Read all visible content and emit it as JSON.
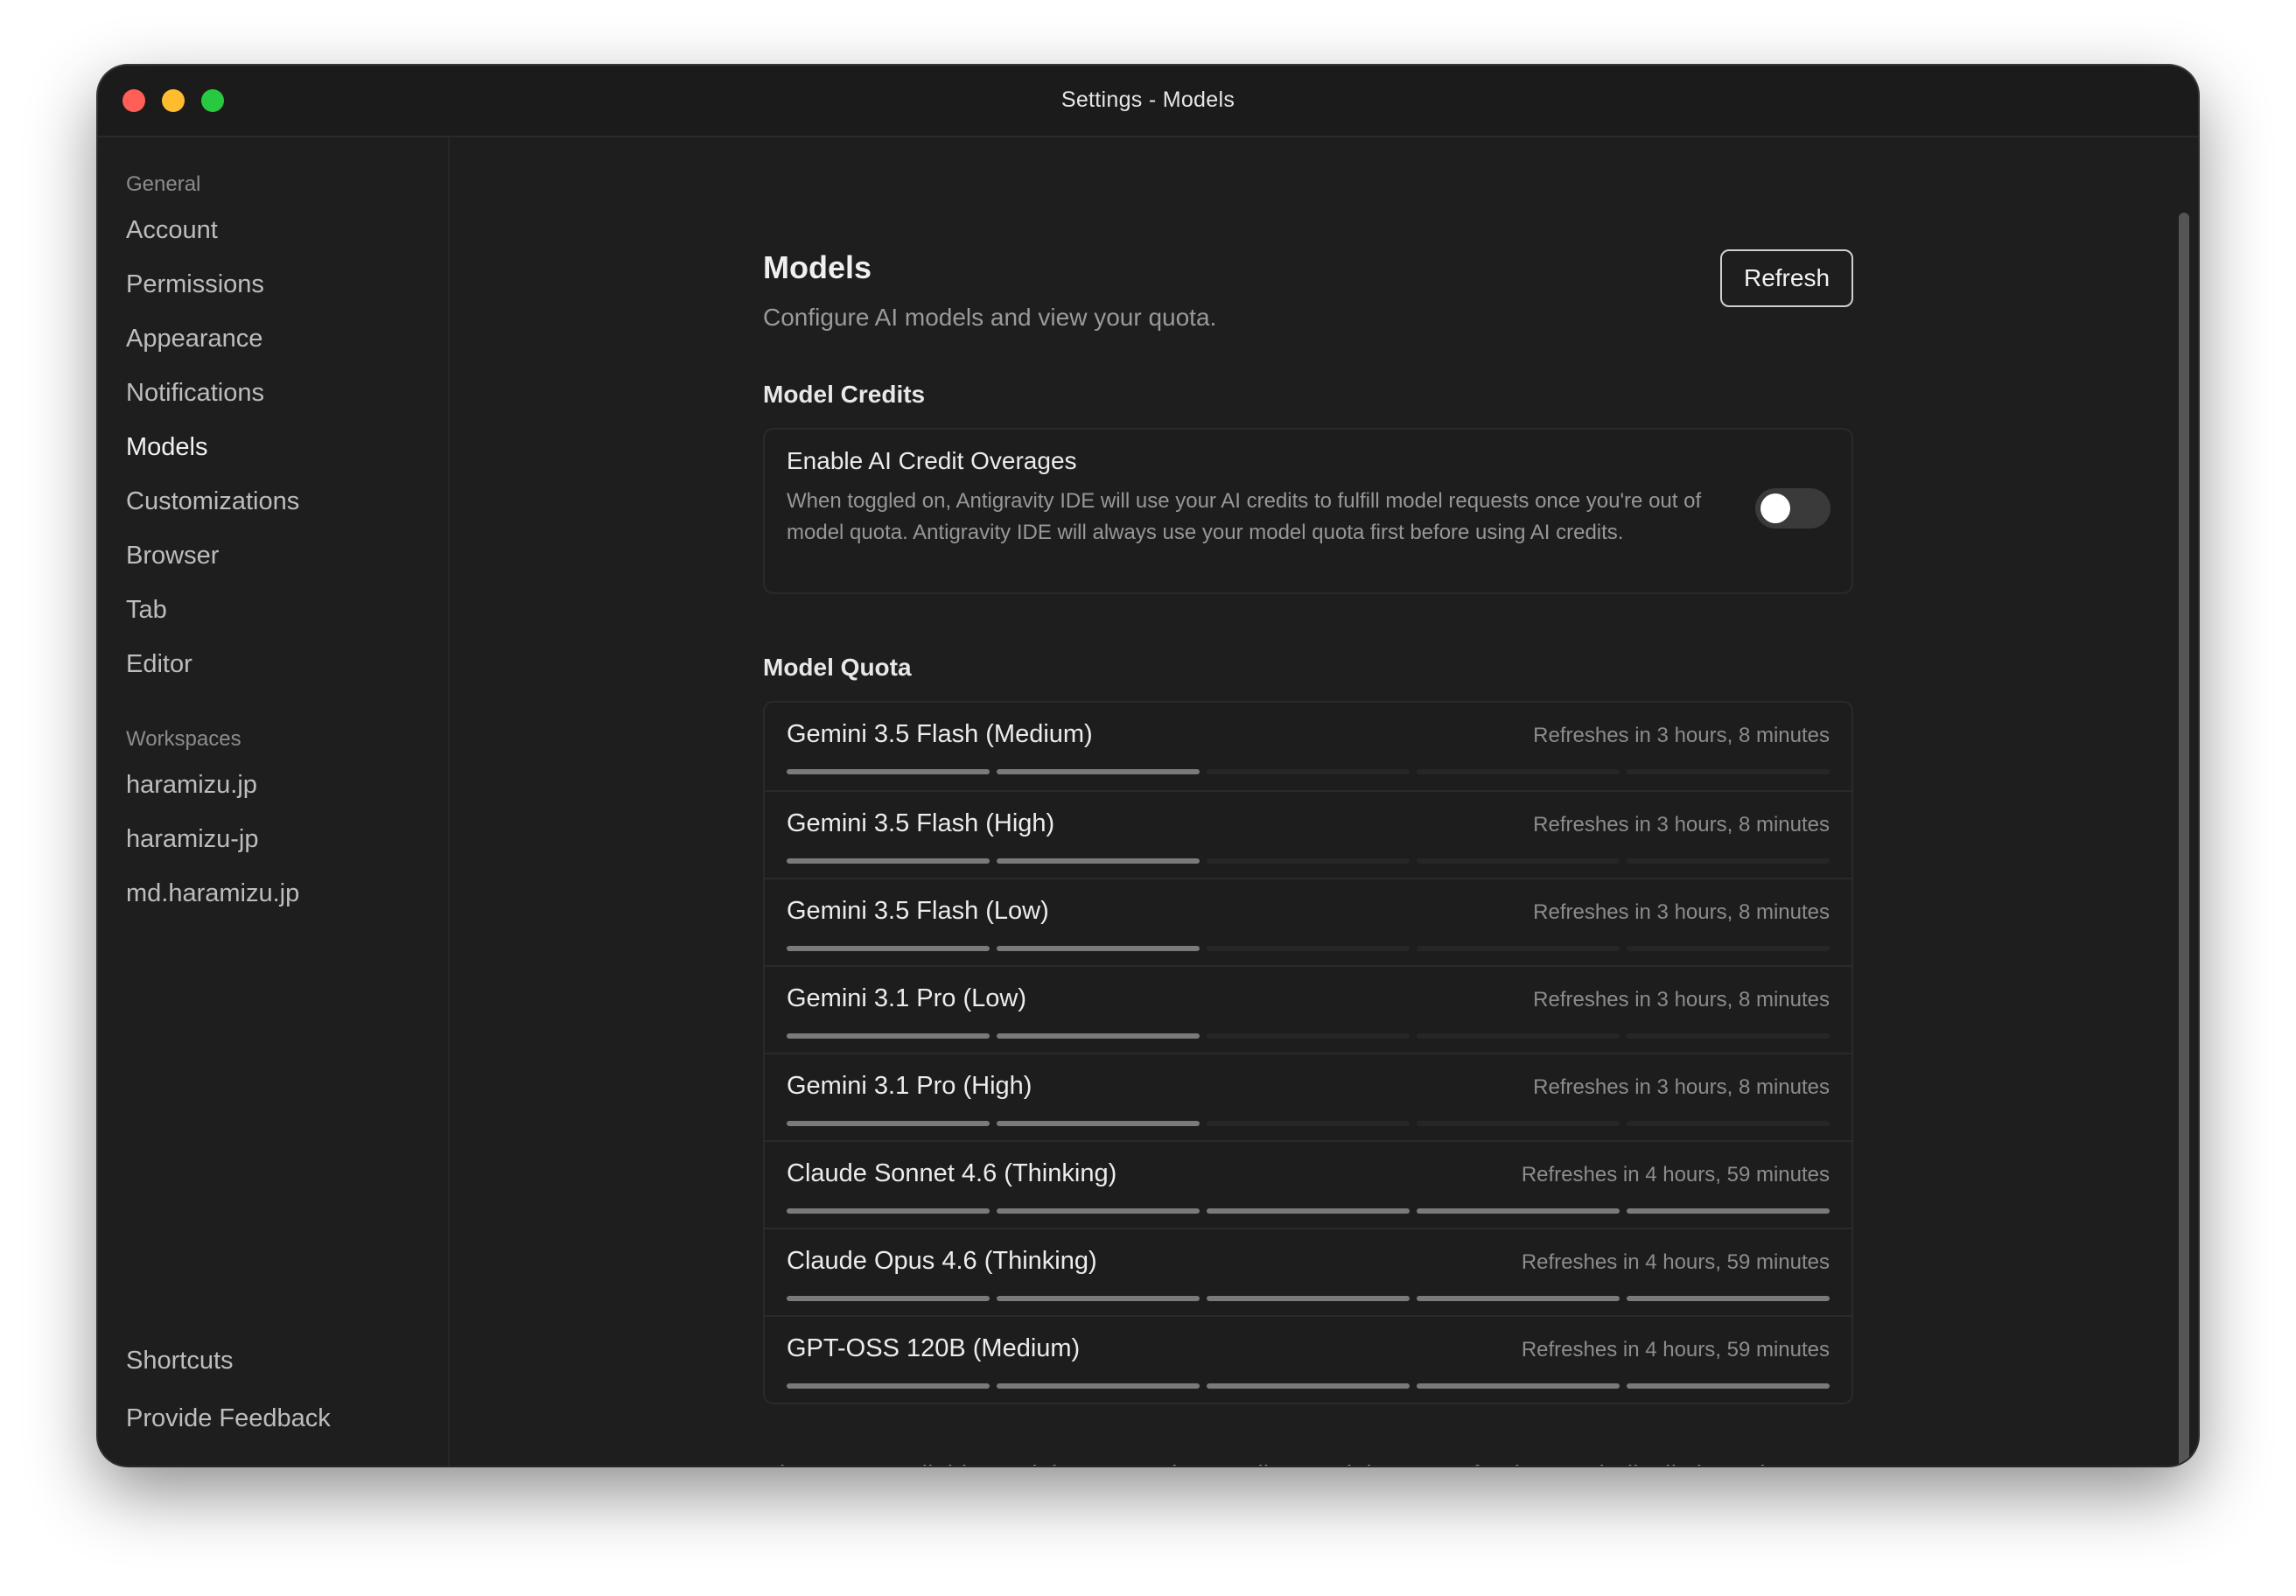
{
  "window": {
    "title": "Settings - Models"
  },
  "sidebar": {
    "general_label": "General",
    "general_items": [
      {
        "label": "Account",
        "active": false
      },
      {
        "label": "Permissions",
        "active": false
      },
      {
        "label": "Appearance",
        "active": false
      },
      {
        "label": "Notifications",
        "active": false
      },
      {
        "label": "Models",
        "active": true
      },
      {
        "label": "Customizations",
        "active": false
      },
      {
        "label": "Browser",
        "active": false
      },
      {
        "label": "Tab",
        "active": false
      },
      {
        "label": "Editor",
        "active": false
      }
    ],
    "workspaces_label": "Workspaces",
    "workspaces": [
      {
        "label": "haramizu.jp"
      },
      {
        "label": "haramizu-jp"
      },
      {
        "label": "md.haramizu.jp"
      }
    ],
    "bottom_items": [
      {
        "label": "Shortcuts"
      },
      {
        "label": "Provide Feedback"
      }
    ]
  },
  "main": {
    "title": "Models",
    "subtitle": "Configure AI models and view your quota.",
    "refresh_label": "Refresh",
    "credits_heading": "Model Credits",
    "overage": {
      "title": "Enable AI Credit Overages",
      "description": "When toggled on, Antigravity IDE will use your AI credits to fulfill model requests once you're out of model quota. Antigravity IDE will always use your model quota first before using AI credits.",
      "enabled": false
    },
    "quota_heading": "Model Quota",
    "quota_segments_total": 5,
    "models": [
      {
        "name": "Gemini 3.5 Flash (Medium)",
        "refresh": "Refreshes in 3 hours, 8 minutes",
        "filled": 2
      },
      {
        "name": "Gemini 3.5 Flash (High)",
        "refresh": "Refreshes in 3 hours, 8 minutes",
        "filled": 2
      },
      {
        "name": "Gemini 3.5 Flash (Low)",
        "refresh": "Refreshes in 3 hours, 8 minutes",
        "filled": 2
      },
      {
        "name": "Gemini 3.1 Pro (Low)",
        "refresh": "Refreshes in 3 hours, 8 minutes",
        "filled": 2
      },
      {
        "name": "Gemini 3.1 Pro (High)",
        "refresh": "Refreshes in 3 hours, 8 minutes",
        "filled": 2
      },
      {
        "name": "Claude Sonnet 4.6 (Thinking)",
        "refresh": "Refreshes in 4 hours, 59 minutes",
        "filled": 5
      },
      {
        "name": "Claude Opus 4.6 (Thinking)",
        "refresh": "Refreshes in 4 hours, 59 minutes",
        "filled": 5
      },
      {
        "name": "GPT-OSS 120B (Medium)",
        "refresh": "Refreshes in 4 hours, 59 minutes",
        "filled": 5
      }
    ],
    "footer": "View your available model quota and AI credits. Model quota refreshes periodically based on your plan. Enable AI Credit Overages to continue using models when your quota is exhausted."
  }
}
